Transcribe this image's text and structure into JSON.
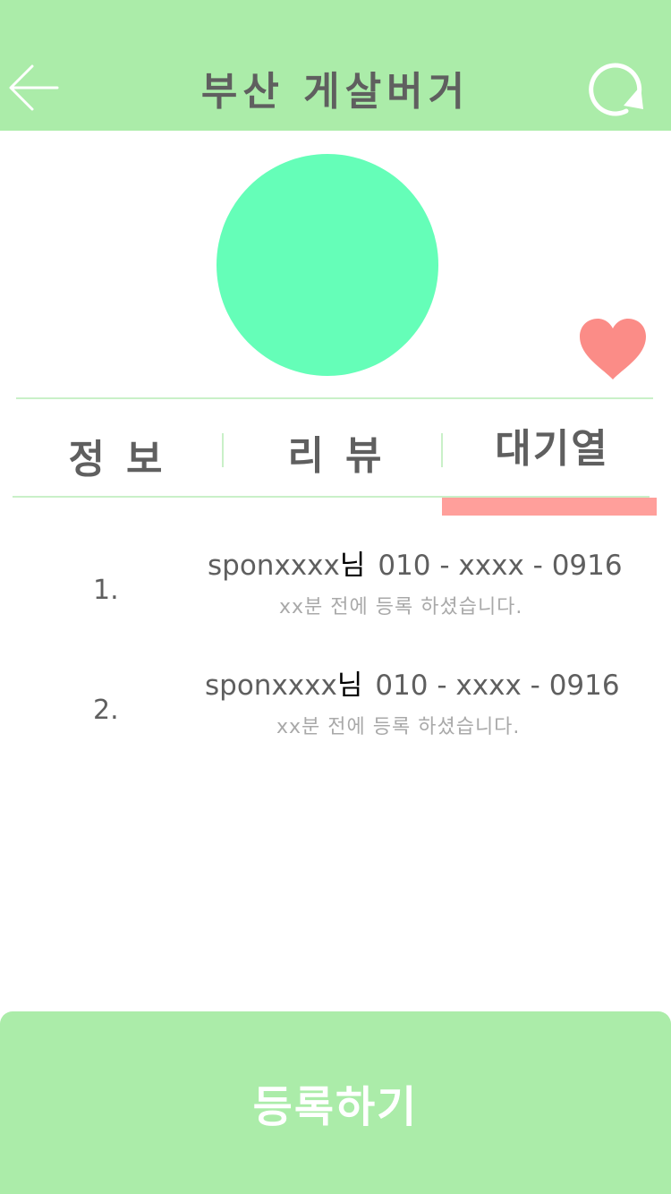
{
  "header": {
    "title": "부산 게살버거",
    "back_icon": "arrow-left-icon",
    "refresh_icon": "refresh-icon"
  },
  "store": {
    "favorite_icon": "heart-icon"
  },
  "tabs": [
    {
      "label": "정보",
      "active": false
    },
    {
      "label": "리뷰",
      "active": false
    },
    {
      "label": "대기열",
      "active": true
    }
  ],
  "queue": [
    {
      "index": "1.",
      "user": "sponxxxx",
      "suffix": "님",
      "phone": "010 - xxxx - 0916",
      "time": "xx분 전에 등록 하셨습니다."
    },
    {
      "index": "2.",
      "user": "sponxxxx",
      "suffix": "님",
      "phone": "010 - xxxx - 0916",
      "time": "xx분 전에 등록 하셨습니다."
    }
  ],
  "register": {
    "label": "등록하기"
  },
  "colors": {
    "header_bg": "#abeca9",
    "accent_green": "#65feb8",
    "tab_indicator": "#ff9f9b",
    "heart": "#fb8c87",
    "text_dark": "#5f5f5f",
    "text_muted": "#a9a9a9"
  }
}
